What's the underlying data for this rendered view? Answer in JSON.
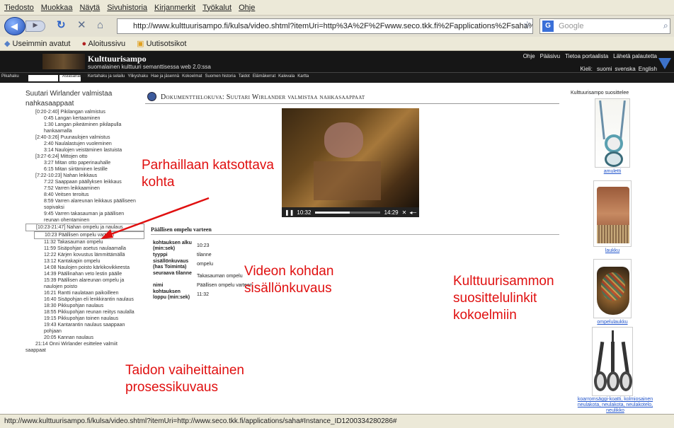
{
  "browser": {
    "menu": [
      "Tiedosto",
      "Muokkaa",
      "Näytä",
      "Sivuhistoria",
      "Kirjanmerkit",
      "Työkalut",
      "Ohje"
    ],
    "url": "http://www.kulttuurisampo.fi/kulsa/video.shtml?itemUri=http%3A%2F%2Fwww.seco.tkk.fi%2Fapplications%2Fsaha%23Instance_II",
    "search_placeholder": "Google",
    "bookmarks": [
      "Useimmin avatut",
      "Aloitussivu",
      "Uutisotsikot"
    ],
    "status": "http://www.kulttuurisampo.fi/kulsa/video.shtml?itemUri=http://www.seco.tkk.fi/applications/saha#Instance_ID1200334280286#"
  },
  "site": {
    "title": "Kulttuurisampo",
    "subtitle": "suomalainen kulttuuri semanttisessa web 2.0:ssa",
    "toplinks": [
      "Ohje",
      "Pääsivu",
      "Tietoa portaalista",
      "Lähetä palautetta"
    ],
    "lang_label": "Kieli:",
    "langs": [
      "suomi",
      "svenska",
      "English"
    ],
    "search_label": "Pikahaku",
    "search2_label": "Asiasanahaku",
    "nav": [
      "Kertahaku ja selailu",
      "Ylikyshaku",
      "Hae ja jäsennä",
      "Kokoelmat",
      "Suomen historia",
      "Taidot",
      "Elämäkerrat",
      "Kalevala",
      "Kartta"
    ]
  },
  "outline": {
    "title": "Suutari Wirlander valmistaa nahkasaappaat",
    "items": [
      {
        "text": "[0:20-2:40] Pikilangan valmistus",
        "level": 1
      },
      {
        "text": "0:45 Langan kertaaminen",
        "level": 2
      },
      {
        "text": "1:30 Langan pikeäminen pikilapulla",
        "level": 2
      },
      {
        "text": "hankaamalla",
        "level": 2
      },
      {
        "text": "[2:40-3:26] Puunaulojen valmistus",
        "level": 1
      },
      {
        "text": "2:40 Naulalastujen vuoleminen",
        "level": 2
      },
      {
        "text": "3:14 Naulojen veistäminen lastuista",
        "level": 2
      },
      {
        "text": "[3:27-6:24] Mittojen otto",
        "level": 1
      },
      {
        "text": "3:27 Mitan otto paperinauhalle",
        "level": 2
      },
      {
        "text": "6:15 Mitan siirtäminen lestille",
        "level": 2
      },
      {
        "text": "[7:22-10:23] Nahan leikkaus",
        "level": 1
      },
      {
        "text": "7:22 Saappaan päällyksen leikkaus",
        "level": 2
      },
      {
        "text": "7:52 Varren leikkaaminen",
        "level": 2
      },
      {
        "text": "8:40 Veitsen teroitus",
        "level": 2
      },
      {
        "text": "8:59 Varren alareunan leikkaus päälliseen",
        "level": 2
      },
      {
        "text": "sopivaksi",
        "level": 2
      },
      {
        "text": "9:45 Varren takasauman ja päällisen",
        "level": 2
      },
      {
        "text": "reunan ohentaminen",
        "level": 2
      },
      {
        "text": "[10:23-21:47] Nahan ompelu ja naulaus",
        "level": 1,
        "selected": true
      },
      {
        "text": "10:23 Päällisen ompelu varteen",
        "level": 2,
        "selected": true
      },
      {
        "text": "11:32 Takasauman ompelu",
        "level": 2
      },
      {
        "text": "11:59 Sisäpohjan asetus naulaamalla",
        "level": 2
      },
      {
        "text": "12:22 Kärjen kovustus lämmittämällä",
        "level": 2
      },
      {
        "text": "13:12 Kantakapin ompelu",
        "level": 2
      },
      {
        "text": "14:08 Naulojen poisto kärkikovikkeesta",
        "level": 2
      },
      {
        "text": "14:39 Päällinahan veto lestin päälle",
        "level": 2
      },
      {
        "text": "15:39 Päällisen alareunan ompelu ja",
        "level": 2
      },
      {
        "text": "naulojen poisto",
        "level": 2
      },
      {
        "text": "16:21 Rantti naulataan paikoilleen",
        "level": 2
      },
      {
        "text": "16:40 Sisäpohjan eli lenkkirantin naulaus",
        "level": 2
      },
      {
        "text": "18:30 Pikkupohjan naulaus",
        "level": 2
      },
      {
        "text": "18:55 Pikkupohjan reunan reiitys naulalla",
        "level": 2
      },
      {
        "text": "19:15 Pikkupohjan toinen naulaus",
        "level": 2
      },
      {
        "text": "19:43 Kantarantin naulaus saappaan",
        "level": 2
      },
      {
        "text": "pohjaan",
        "level": 2
      },
      {
        "text": "20:05 Kannan naulaus",
        "level": 2
      },
      {
        "text": "21:14 Onni Wirlander esittelee valmiit",
        "level": 1
      },
      {
        "text": "saappaat",
        "level": 0
      }
    ]
  },
  "main": {
    "doc_title": "Dokumenttielokuva: Suutari Wirlander valmistaa nahkasaappaat",
    "video": {
      "current": "10:32",
      "total": "14:29",
      "progress": 0.53
    },
    "section_title": "Päällisen ompelu varteen",
    "details": [
      {
        "label": "kohtauksen alku (min:sek)",
        "value": "10:23"
      },
      {
        "label": "tyyppi",
        "value": "tilanne"
      },
      {
        "label": "sisällönkuvaus (has Toiminta)",
        "value": "ompelu"
      },
      {
        "label": "seuraava tilanne",
        "value": "Takasauman ompelu"
      },
      {
        "label": "nimi",
        "value": "Päällisen ompelu varteen"
      },
      {
        "label": "kohtauksen loppu (min:sek)",
        "value": "11:32"
      }
    ]
  },
  "suggestions": {
    "title": "Kulttuurisampo suosittelee",
    "items": [
      {
        "caption": "amuletti"
      },
      {
        "caption": "laukku"
      },
      {
        "caption": "ompelulaukku"
      },
      {
        "caption": "koarromsäggi-koatti, kolmiosainen neulakota, neulakota, neulakotelo, neulikko"
      }
    ]
  },
  "annotations": {
    "a1": "Parhaillaan katsottava kohta",
    "a2": "Videon kohdan sisällönkuvaus",
    "a3": "Kulttuurisammon suosittelulinkit kokoelmiin",
    "a4": "Taidon vaiheittainen prosessikuvaus"
  }
}
